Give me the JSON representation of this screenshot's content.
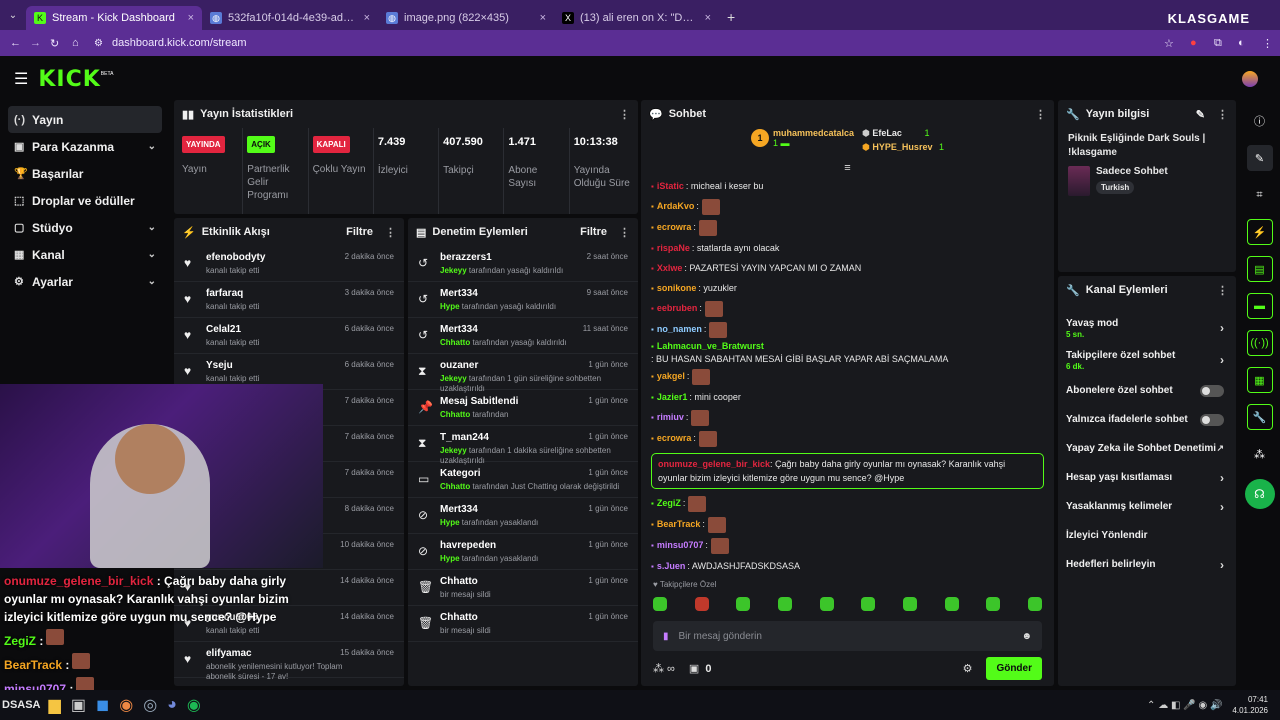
{
  "browser": {
    "tabs": [
      {
        "label": "Stream - Kick Dashboard",
        "close": "×",
        "active": true,
        "fav": "K",
        "favc": "#53fc18"
      },
      {
        "label": "532fa10f-014d-4e39-adc2-0568",
        "close": "×",
        "active": false,
        "fav": "◍",
        "favc": "#5a7bd6"
      },
      {
        "label": "image.png (822×435)",
        "close": "×",
        "active": false,
        "fav": "◍",
        "favc": "#5a7bd6"
      },
      {
        "label": "(13) ali eren on X: \"Dark Souls 3",
        "close": "×",
        "active": false,
        "fav": "X",
        "favc": "#000"
      }
    ],
    "new_tab": "+",
    "url": "dashboard.kick.com/stream",
    "brand": "KLASGAME"
  },
  "nav": {
    "logo": "KICK",
    "logo_tag": "BETA"
  },
  "sidebar": {
    "items": [
      {
        "label": "Yayın",
        "icon": "(·)",
        "chev": "",
        "active": true
      },
      {
        "label": "Para Kazanma",
        "icon": "▣",
        "chev": "⌄",
        "active": false
      },
      {
        "label": "Başarılar",
        "icon": "🏆",
        "chev": "",
        "active": false
      },
      {
        "label": "Droplar ve ödüller",
        "icon": "⬚",
        "chev": "",
        "active": false
      },
      {
        "label": "Stüdyo",
        "icon": "▢",
        "chev": "⌄",
        "active": false
      },
      {
        "label": "Kanal",
        "icon": "▦",
        "chev": "⌄",
        "active": false
      },
      {
        "label": "Ayarlar",
        "icon": "⚙",
        "chev": "⌄",
        "active": false
      }
    ]
  },
  "stats": {
    "title": "Yayın İstatistikleri",
    "items": [
      {
        "pill": "YAYINDA",
        "pillc": "#e2253f",
        "pillt": "#fff",
        "label": "Yayın"
      },
      {
        "pill": "AÇIK",
        "pillc": "#53fc18",
        "pillt": "#0b0b0d",
        "label": "Partnerlik Gelir Programı"
      },
      {
        "pill": "KAPALI",
        "pillc": "#e2253f",
        "pillt": "#fff",
        "label": "Çoklu Yayın"
      },
      {
        "value": "7.439",
        "label": "İzleyici"
      },
      {
        "value": "407.590",
        "label": "Takipçi"
      },
      {
        "value": "1.471",
        "label": "Abone Sayısı"
      },
      {
        "value": "10:13:38",
        "label": "Yayında Olduğu Süre"
      }
    ]
  },
  "activity": {
    "title": "Etkinlik Akışı",
    "filter": "Filtre",
    "rows": [
      {
        "name": "efenobodyty",
        "sub": "kanalı takip etti",
        "time": "2 dakika önce"
      },
      {
        "name": "farfaraq",
        "sub": "kanalı takip etti",
        "time": "3 dakika önce"
      },
      {
        "name": "Celal21",
        "sub": "kanalı takip etti",
        "time": "6 dakika önce"
      },
      {
        "name": "Yseju",
        "sub": "kanalı takip etti",
        "time": "6 dakika önce"
      },
      {
        "name": "",
        "sub": "",
        "time": "7 dakika önce"
      },
      {
        "name": "",
        "sub": "",
        "time": "7 dakika önce"
      },
      {
        "name": "",
        "sub": "",
        "time": "7 dakika önce"
      },
      {
        "name": "",
        "sub": "",
        "time": "8 dakika önce"
      },
      {
        "name": "",
        "sub": "",
        "time": "10 dakika önce"
      },
      {
        "name": "",
        "sub": "",
        "time": "14 dakika önce"
      },
      {
        "name": "yuncu6005",
        "sub": "kanalı takip etti",
        "time": "14 dakika önce"
      },
      {
        "name": "elifyamac",
        "sub": "abonelik yenilemesini kutluyor! Toplam abonelik süresi - 17 av!",
        "time": "15 dakika önce"
      }
    ]
  },
  "moderation": {
    "title": "Denetim Eylemleri",
    "filter": "Filtre",
    "rows": [
      {
        "icon": "↺",
        "name": "berazzers1",
        "by": "Jekeyy",
        "sub": " tarafından yasağı kaldırıldı",
        "time": "2 saat önce"
      },
      {
        "icon": "↺",
        "name": "Mert334",
        "by": "Hype",
        "sub": " tarafından yasağı kaldırıldı",
        "time": "9 saat önce"
      },
      {
        "icon": "↺",
        "name": "Mert334",
        "by": "Chhatto",
        "sub": " tarafından yasağı kaldırıldı",
        "time": "11 saat önce"
      },
      {
        "icon": "⧗",
        "name": "ouzaner",
        "by": "Jekeyy",
        "sub": " tarafından 1 gün süreliğine sohbetten uzaklaştırıldı",
        "time": "1 gün önce"
      },
      {
        "icon": "📌",
        "name": "Mesaj Sabitlendi",
        "by": "Chhatto",
        "sub": " tarafından",
        "time": "1 gün önce"
      },
      {
        "icon": "⧗",
        "name": "T_man244",
        "by": "Jekeyy",
        "sub": " tarafından 1 dakika süreliğine sohbetten uzaklaştırıldı",
        "time": "1 gün önce"
      },
      {
        "icon": "▭",
        "name": "Kategori",
        "by": "Chhatto",
        "sub": " tarafından Just Chatting olarak değiştirildi",
        "time": "1 gün önce"
      },
      {
        "icon": "⊘",
        "name": "Mert334",
        "by": "Hype",
        "sub": " tarafından yasaklandı",
        "time": "1 gün önce"
      },
      {
        "icon": "⊘",
        "name": "havrepeden",
        "by": "Hype",
        "sub": " tarafından yasaklandı",
        "time": "1 gün önce"
      },
      {
        "icon": "🗑",
        "name": "Chhatto",
        "by": "",
        "sub": "bir mesajı sildi",
        "time": "1 gün önce"
      },
      {
        "icon": "🗑",
        "name": "Chhatto",
        "by": "",
        "sub": "bir mesajı sildi",
        "time": "1 gün önce"
      }
    ]
  },
  "chat": {
    "title": "Sohbet",
    "top": [
      {
        "rank": "1",
        "name": "muhammedcatalca",
        "count": "1"
      },
      {
        "rank": "",
        "name": "EfeLac",
        "count": "1"
      },
      {
        "rank": "",
        "name": "HYPE_Husrev",
        "count": "1"
      }
    ],
    "messages": [
      {
        "user": "iStatic",
        "color": "#e2253f",
        "text": ": micheal i keser bu",
        "emote": false
      },
      {
        "user": "ArdaKvo",
        "color": "#f5a623",
        "text": ":",
        "emote": true
      },
      {
        "user": "ecrowra",
        "color": "#f5a623",
        "text": ":",
        "emote": true
      },
      {
        "user": "rispaNe",
        "color": "#e2253f",
        "text": ": statlarda aynı olacak",
        "emote": false
      },
      {
        "user": "Xxlwe",
        "color": "#e2253f",
        "text": ": PAZARTESİ YAYIN YAPCAN MI O ZAMAN",
        "emote": false
      },
      {
        "user": "sonikone",
        "color": "#f5a623",
        "text": ": yuzukler",
        "emote": false
      },
      {
        "user": "eebruben",
        "color": "#e2253f",
        "text": ":",
        "emote": true
      },
      {
        "user": "no_namen",
        "color": "#8ecbff",
        "text": ":",
        "emote": true
      },
      {
        "user": "Lahmacun_ve_Bratwurst",
        "color": "#53fc18",
        "text": ": BU HASAN SABAHTAN MESAİ GİBİ BAŞLAR YAPAR ABİ SAÇMALAMA",
        "emote": false
      },
      {
        "user": "yakgel",
        "color": "#f5a623",
        "text": ":",
        "emote": true
      },
      {
        "user": "Jazier1",
        "color": "#53fc18",
        "text": ": mini cooper",
        "emote": false
      },
      {
        "user": "rimiuv",
        "color": "#c57cff",
        "text": ":",
        "emote": true
      },
      {
        "user": "ecrowra",
        "color": "#f5a623",
        "text": ":",
        "emote": true
      }
    ],
    "highlight": {
      "user": "onumuze_gelene_bir_kick",
      "text": ": Çağrı baby daha girly oyunlar mı oynasak? Karanlık vahşi oyunlar bizim izleyici kitlemize göre uygun mu sence? @Hype"
    },
    "messages2": [
      {
        "user": "ZegiZ",
        "color": "#53fc18",
        "text": ":",
        "emote": true
      },
      {
        "user": "BearTrack",
        "color": "#f5a623",
        "text": ":",
        "emote": true
      },
      {
        "user": "minsu0707",
        "color": "#c57cff",
        "text": ":",
        "emote": true
      },
      {
        "user": "s.Juen",
        "color": "#c57cff",
        "text": ": AWDJASHJFADSKDSASA",
        "emote": false
      }
    ],
    "followers_only": "Takipçilere Özel",
    "placeholder": "Bir mesaj gönderin",
    "count": "0",
    "send": "Gönder"
  },
  "streaminfo": {
    "title": "Yayın bilgisi",
    "stream_title": "Piknik Eşliğinde Dark Souls | !klasgame",
    "category": "Sadece Sohbet",
    "language": "Turkish"
  },
  "channel": {
    "title": "Kanal Eylemleri",
    "items": [
      {
        "label": "Yavaş mod",
        "sub": "5 sn.",
        "kind": "chev"
      },
      {
        "label": "Takipçilere özel sohbet",
        "sub": "6 dk.",
        "kind": "chev"
      },
      {
        "label": "Abonelere özel sohbet",
        "sub": "",
        "kind": "toggle"
      },
      {
        "label": "Yalnızca ifadelerle sohbet",
        "sub": "",
        "kind": "toggle"
      },
      {
        "label": "Yapay Zeka ile Sohbet Denetimi",
        "sub": "",
        "kind": "ext"
      },
      {
        "label": "Hesap yaşı kısıtlaması",
        "sub": "",
        "kind": "chev"
      },
      {
        "label": "Yasaklanmış kelimeler",
        "sub": "",
        "kind": "chev"
      },
      {
        "label": "İzleyici Yönlendir",
        "sub": "",
        "kind": "none"
      },
      {
        "label": "Hedefleri belirleyin",
        "sub": "",
        "kind": "chev"
      }
    ]
  },
  "overlay": {
    "lines": [
      {
        "user": "onumuze_gelene_bir_kick",
        "color": "#e2253f",
        "text": " : Çağrı baby daha girly oyunlar mı oynasak? Karanlık vahşi oyunlar bizim izleyici kitlemize göre uygun mu sence? @Hype"
      },
      {
        "user": "ZegiZ",
        "color": "#53fc18",
        "text": " :"
      },
      {
        "user": "BearTrack",
        "color": "#f5a623",
        "text": " :"
      },
      {
        "user": "minsu0707",
        "color": "#c57cff",
        "text": " :"
      }
    ],
    "footer": "DSASA"
  },
  "taskbar": {
    "time": "07:41",
    "date": "4.01.2026"
  },
  "colors": {
    "accent": "#53fc18",
    "panel": "#18191d",
    "browser": "#5b2e94"
  }
}
